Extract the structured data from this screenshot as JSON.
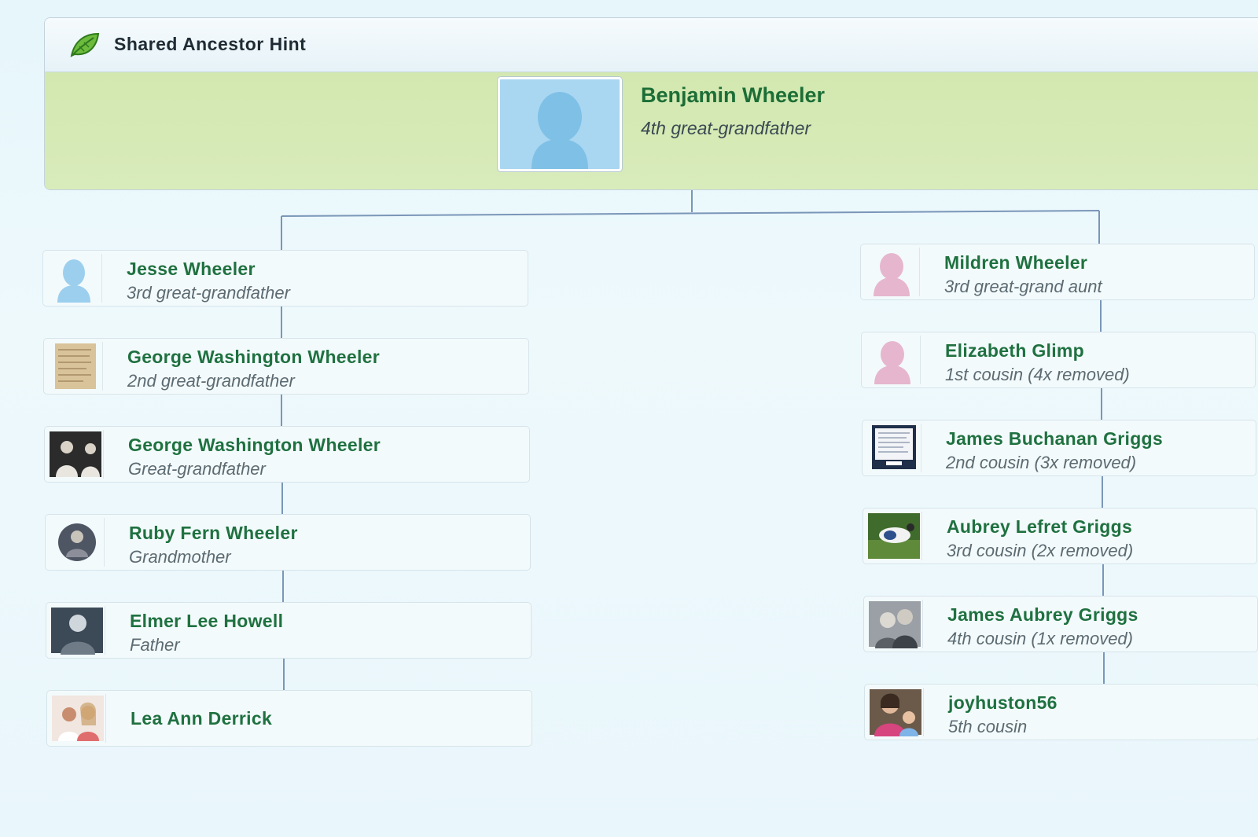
{
  "panel": {
    "title": "Shared Ancestor Hint",
    "icon": "leaf-icon"
  },
  "ancestor": {
    "name": "Benjamin Wheeler",
    "relationship": "4th great-grandfather",
    "photo": "male-silhouette"
  },
  "left_branch": [
    {
      "name": "Jesse Wheeler",
      "relationship": "3rd great-grandfather",
      "photo": "male-silhouette"
    },
    {
      "name": "George Washington Wheeler",
      "relationship": "2nd great-grandfather",
      "photo": "document-photo"
    },
    {
      "name": "George Washington Wheeler",
      "relationship": "Great-grandfather",
      "photo": "group-photo"
    },
    {
      "name": "Ruby Fern Wheeler",
      "relationship": "Grandmother",
      "photo": "portrait-photo"
    },
    {
      "name": "Elmer Lee Howell",
      "relationship": "Father",
      "photo": "portrait-photo"
    },
    {
      "name": "Lea Ann Derrick",
      "relationship": "",
      "photo": "couple-photo"
    }
  ],
  "right_branch": [
    {
      "name": "Mildren Wheeler",
      "relationship": "3rd great-grand aunt",
      "photo": "female-silhouette"
    },
    {
      "name": "Elizabeth Glimp",
      "relationship": "1st cousin (4x removed)",
      "photo": "female-silhouette"
    },
    {
      "name": "James Buchanan Griggs",
      "relationship": "2nd cousin (3x removed)",
      "photo": "document-photo"
    },
    {
      "name": "Aubrey Lefret Griggs",
      "relationship": "3rd cousin (2x removed)",
      "photo": "outdoor-photo"
    },
    {
      "name": "James Aubrey Griggs",
      "relationship": "4th cousin (1x removed)",
      "photo": "couple-photo"
    },
    {
      "name": "joyhuston56",
      "relationship": "5th cousin",
      "photo": "family-photo"
    }
  ],
  "colors": {
    "name_green": "#1f7140",
    "ancestor_band": "#d3e8b0",
    "connector": "#7a96b8",
    "male_silhouette": "#7fc0e6",
    "female_silhouette": "#e6b6cf"
  }
}
